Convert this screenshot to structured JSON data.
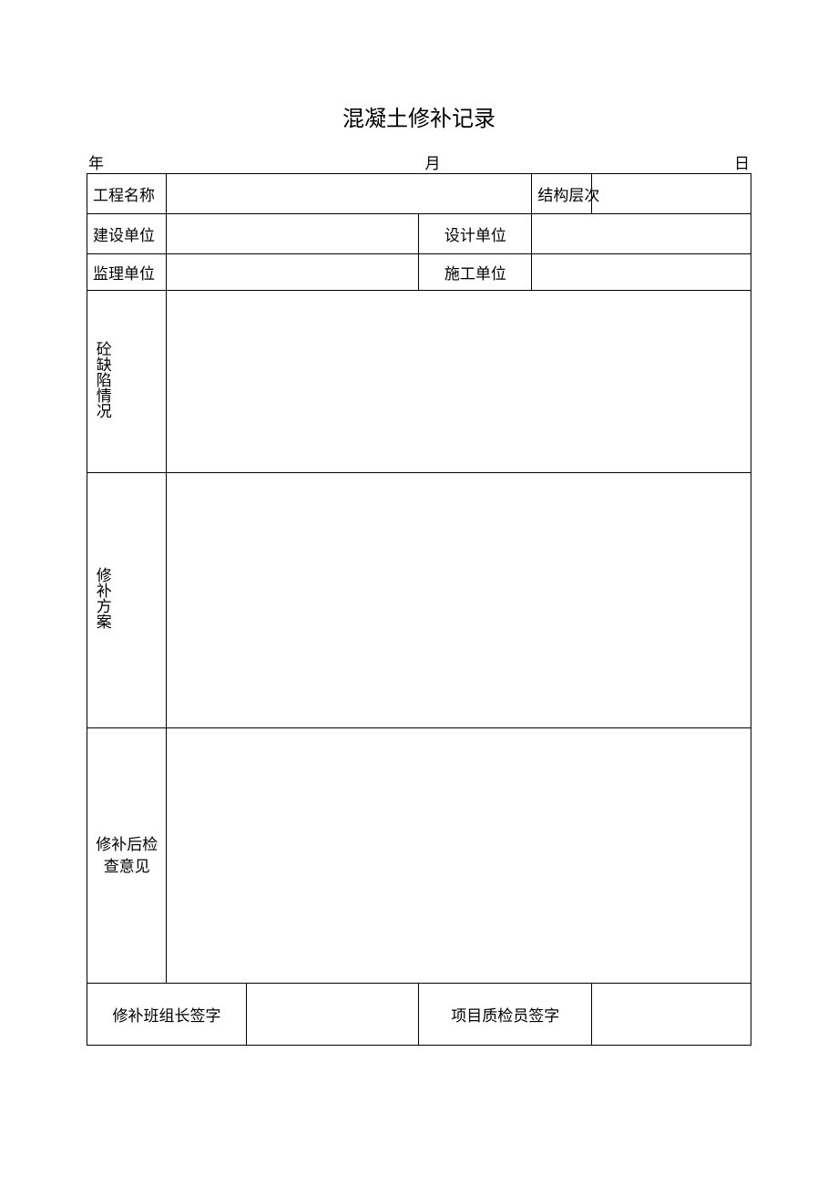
{
  "title": "混凝土修补记录",
  "date": {
    "year": "年",
    "month": "月",
    "day": "日"
  },
  "rows": {
    "project_name_label": "工程名称",
    "project_name_value": "",
    "structure_level_label": "结构层次",
    "structure_level_value": "",
    "build_unit_label": "建设单位",
    "build_unit_value": "",
    "design_unit_label": "设计单位",
    "design_unit_value": "",
    "supervise_unit_label": "监理单位",
    "supervise_unit_value": "",
    "construct_unit_label": "施工单位",
    "construct_unit_value": "",
    "defect_label": "砼缺陷情况",
    "defect_value": "",
    "repair_plan_label": "修补方案",
    "repair_plan_value": "",
    "post_inspect_label": "修补后检查意见",
    "post_inspect_value": "",
    "team_leader_sig_label": "修补班组长签字",
    "team_leader_sig_value": "",
    "inspector_sig_label": "项目质检员签字",
    "inspector_sig_value": ""
  }
}
